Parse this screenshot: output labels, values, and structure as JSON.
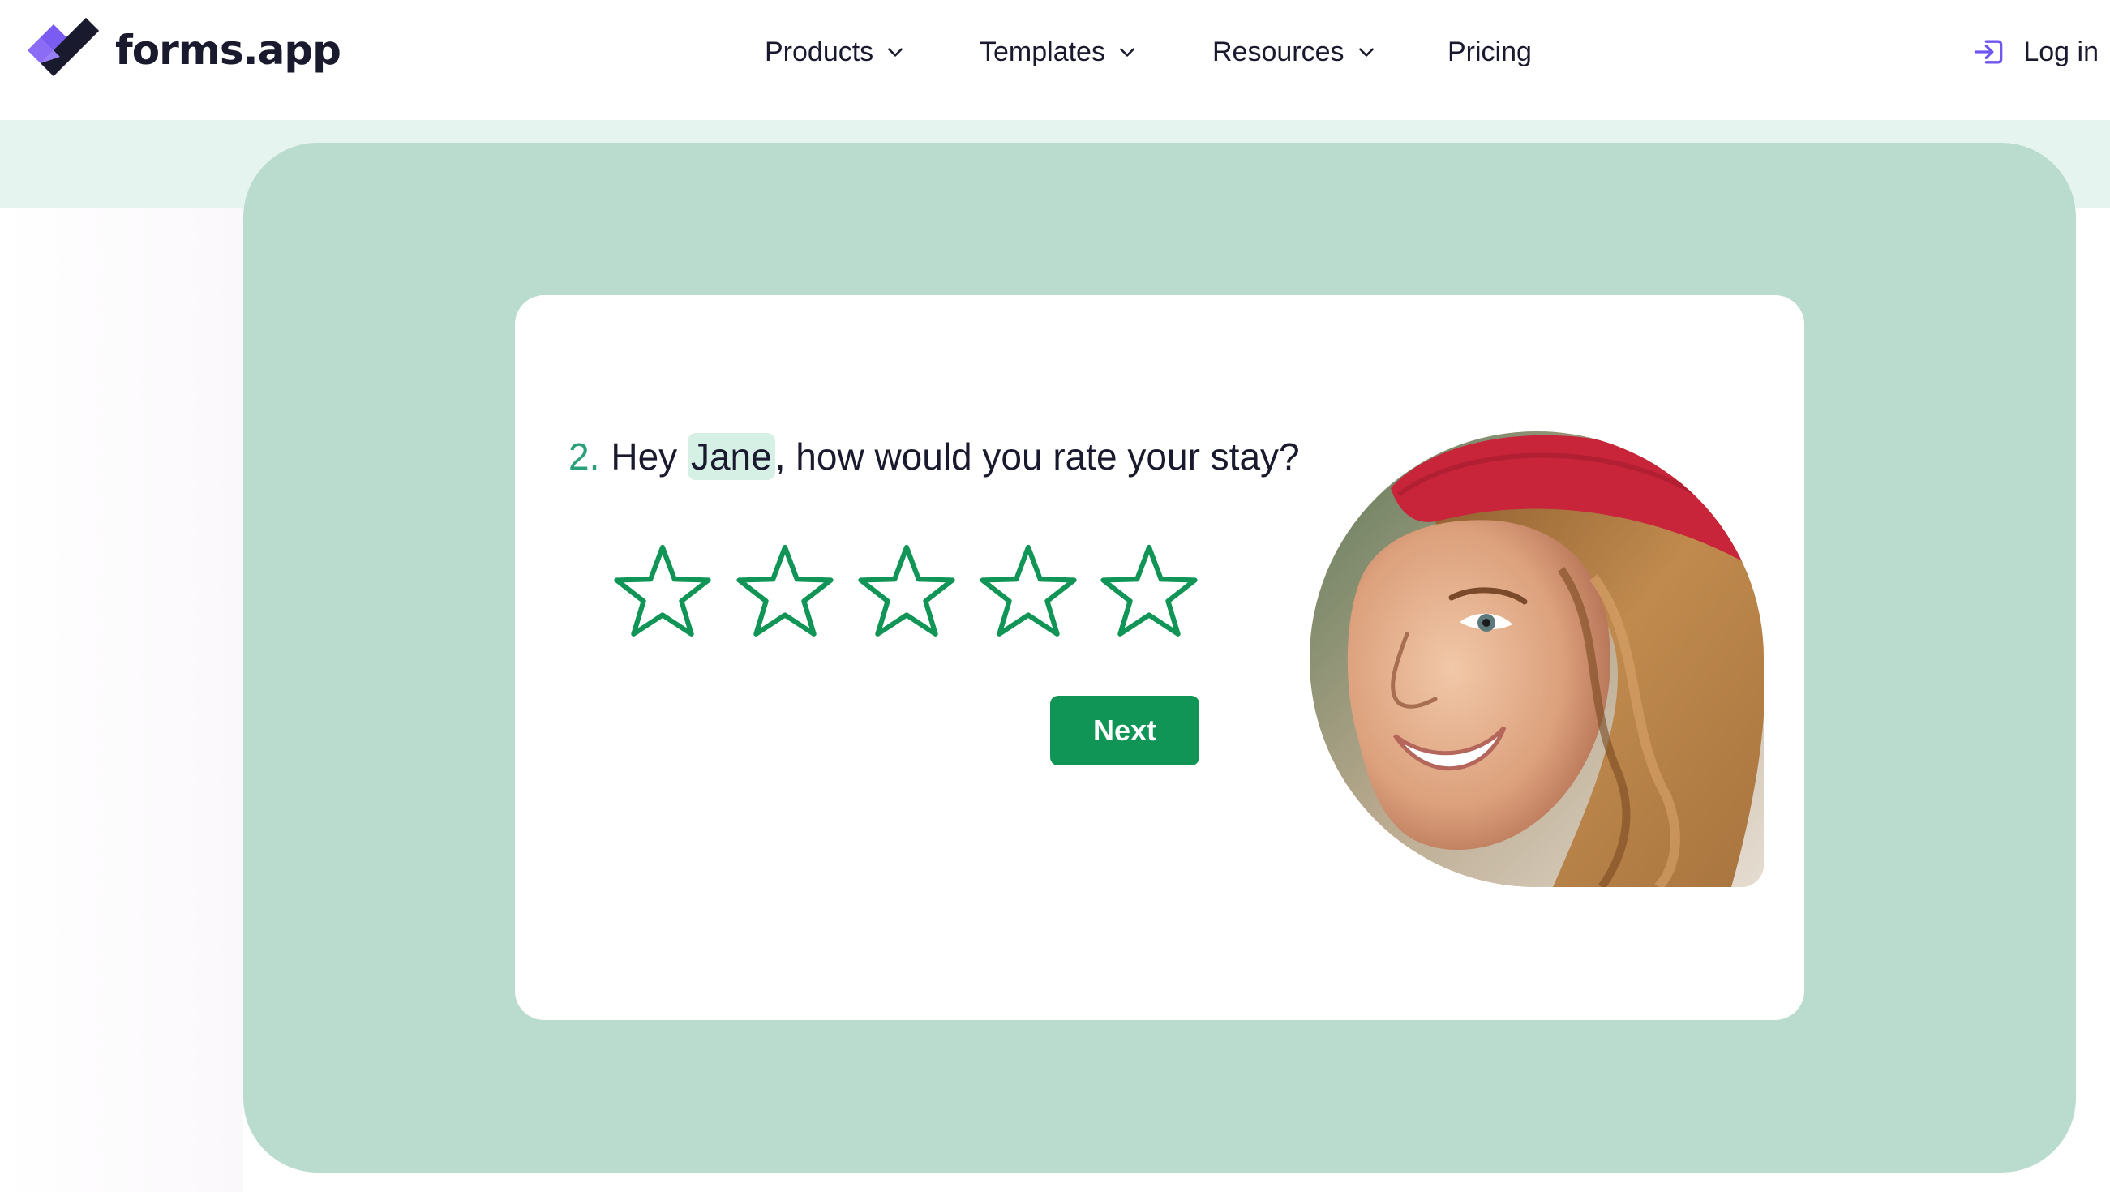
{
  "brand": {
    "name": "forms.app",
    "accent": "#6e56f0",
    "accent_dark": "#1a1a2e"
  },
  "nav": {
    "items": [
      {
        "label": "Products",
        "has_dropdown": true
      },
      {
        "label": "Templates",
        "has_dropdown": true
      },
      {
        "label": "Resources",
        "has_dropdown": true
      },
      {
        "label": "Pricing",
        "has_dropdown": false
      }
    ],
    "login_label": "Log in",
    "login_icon": "log-in-icon"
  },
  "form": {
    "question_number": "2.",
    "question_before": "Hey ",
    "respondent_name": "Jane",
    "question_after": ", how would you rate your stay?",
    "rating": {
      "max": 5,
      "selected": 0,
      "icon": "star-outline-icon"
    },
    "next_label": "Next",
    "accent": "#119557",
    "panel_color": "#badccf"
  }
}
